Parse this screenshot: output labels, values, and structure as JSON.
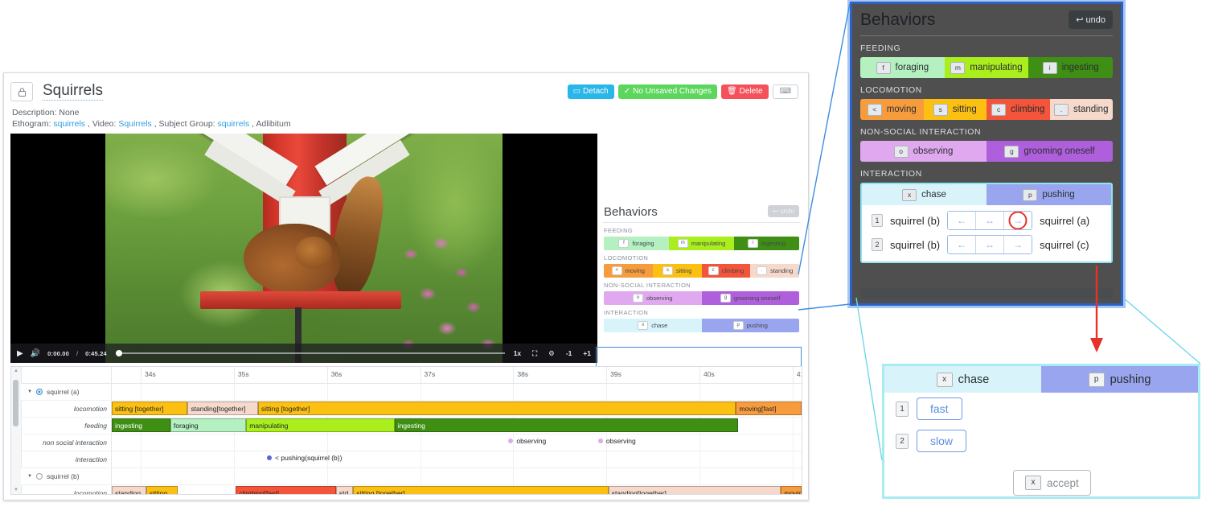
{
  "app": {
    "title": "Squirrels",
    "lock_icon": "lock-icon",
    "buttons": {
      "detach": "Detach",
      "detach_icon": "detach-icon",
      "saved": "No Unsaved Changes",
      "saved_icon": "check-icon",
      "delete": "Delete",
      "delete_icon": "trash-icon",
      "keyboard_icon": "keyboard-icon"
    },
    "meta": {
      "description_label": "Description:",
      "description_value": "None",
      "ethogram_label": "Ethogram:",
      "ethogram_value": "squirrels",
      "video_label": "Video:",
      "video_value": "Squirrels",
      "subject_group_label": "Subject Group:",
      "subject_group_value": "squirrels",
      "sampling": "Adlibitum"
    }
  },
  "video_controls": {
    "play_icon": "play-icon",
    "volume_icon": "volume-icon",
    "current_time": "0:00.00",
    "separator": "/",
    "duration": "0:45.24",
    "speed": "1x",
    "fullscreen_icon": "fullscreen-icon",
    "settings_icon": "gear-icon",
    "step_back": "-1",
    "step_forward": "+1"
  },
  "behaviors_panel": {
    "title": "Behaviors",
    "undo_label": "undo",
    "undo_icon": "undo-arrow-icon",
    "categories": [
      {
        "name": "FEEDING",
        "items": [
          {
            "key": "f",
            "label": "foraging",
            "color": "#b4f0c0"
          },
          {
            "key": "m",
            "label": "manipulating",
            "color": "#aaee1e"
          },
          {
            "key": "i",
            "label": "ingesting",
            "color": "#3f8f14"
          }
        ]
      },
      {
        "name": "LOCOMOTION",
        "items": [
          {
            "key": "<",
            "label": "moving",
            "color": "#f7a martin"
          },
          {
            "key": "s",
            "label": "sitting",
            "color": "#fcc012"
          },
          {
            "key": "c",
            "label": "climbing",
            "color": "#f4543a"
          },
          {
            "key": ".",
            "label": "standing",
            "color": "#f6d9cb"
          }
        ]
      },
      {
        "name": "NON-SOCIAL INTERACTION",
        "items": [
          {
            "key": "o",
            "label": "observing",
            "color": "#e0a9ef"
          },
          {
            "key": "g",
            "label": "grooming oneself",
            "color": "#b martin"
          }
        ]
      },
      {
        "name": "INTERACTION",
        "items": [
          {
            "key": "x",
            "label": "chase",
            "color": "#d8f4fa"
          },
          {
            "key": "p",
            "label": "pushing",
            "color": "#9aa5ef"
          }
        ]
      }
    ]
  },
  "colors": {
    "foraging": "#b4f0c0",
    "manipulating": "#aaee1e",
    "ingesting": "#3f8f14",
    "moving": "#f79c3c",
    "sitting": "#fcc012",
    "climbing": "#f4543a",
    "standing": "#f6d9cb",
    "observing": "#e0a9ef",
    "grooming": "#b05fdc",
    "chase": "#d8f4fa",
    "pushing": "#9aa5ef",
    "accent_blue": "#2f8fe0",
    "callout_blue": "#2b62c4",
    "callout_cyan": "#8fe3ef",
    "arrow_red": "#e8312a"
  },
  "timeline": {
    "ticks": [
      "34s",
      "35s",
      "36s",
      "37s",
      "38s",
      "39s",
      "40s",
      "41"
    ],
    "subjects": [
      {
        "name": "squirrel (a)",
        "selected": true,
        "rows": [
          {
            "label": "locomotion",
            "events": [
              {
                "text": "sitting [together]",
                "start": 0,
                "end": 11.0,
                "color": "#fcc012"
              },
              {
                "text": "standing[together]",
                "start": 11.0,
                "end": 21.2,
                "color": "#f6d9cb"
              },
              {
                "text": "sitting [together]",
                "start": 21.2,
                "end": 90.5,
                "color": "#fcc012"
              },
              {
                "text": "moving[fast]",
                "start": 90.5,
                "end": 100,
                "color": "#f79c3c"
              }
            ]
          },
          {
            "label": "feeding",
            "events": [
              {
                "text": "ingesting",
                "start": 0,
                "end": 8.5,
                "color": "#3f8f14"
              },
              {
                "text": "foraging",
                "start": 8.5,
                "end": 19.5,
                "color": "#b4f0c0"
              },
              {
                "text": "manipulating",
                "start": 19.5,
                "end": 41.0,
                "color": "#aaee1e"
              },
              {
                "text": "ingesting",
                "start": 41.0,
                "end": 90.8,
                "color": "#3f8f14"
              }
            ]
          },
          {
            "label": "non social interaction",
            "points": [
              {
                "text": "observing",
                "pos": 57.5,
                "color": "#e0a9ef"
              },
              {
                "text": "observing",
                "pos": 70.5,
                "color": "#e0a9ef"
              }
            ]
          },
          {
            "label": "interaction",
            "points": [
              {
                "text": "< pushing(squirrel (b))",
                "pos": 22.5,
                "color": "#5566dd"
              }
            ]
          }
        ]
      },
      {
        "name": "squirrel (b)",
        "selected": false,
        "rows": [
          {
            "label": "locomotion",
            "events": [
              {
                "text": "standing",
                "start": 0,
                "end": 5.0,
                "color": "#f6d9cb"
              },
              {
                "text": "sitting",
                "start": 5.0,
                "end": 9.5,
                "color": "#fcc012"
              },
              {
                "text": "",
                "start": 9.5,
                "end": 18.0,
                "color": "#ffffff"
              },
              {
                "text": "climbing[fast]",
                "start": 18.0,
                "end": 32.5,
                "color": "#f4543a"
              },
              {
                "text": "std",
                "start": 32.5,
                "end": 35.0,
                "color": "#f6d9cb"
              },
              {
                "text": "sitting [together]",
                "start": 35.0,
                "end": 72.0,
                "color": "#fcc012"
              },
              {
                "text": "standing[together]",
                "start": 72.0,
                "end": 86.0,
                "color": "#f6d9cb"
              },
              {
                "text": "moving[fa",
                "start": 97.0,
                "end": 100,
                "color": "#f79c3c"
              }
            ]
          }
        ]
      }
    ]
  },
  "zoom_behaviors": {
    "title": "Behaviors",
    "undo_label": "undo",
    "interaction_label": "INTERACTION",
    "tabs": [
      {
        "key": "x",
        "label": "chase",
        "color": "#d8f4fa"
      },
      {
        "key": "p",
        "label": "pushing",
        "color": "#9aa5ef"
      }
    ],
    "modifier_rows": [
      {
        "num": "1",
        "subject_left": "squirrel (b)",
        "subject_right": "squirrel (a)",
        "arrows": [
          "←",
          "↔",
          "→"
        ],
        "selected_arrow": 2,
        "highlighted": true
      },
      {
        "num": "2",
        "subject_left": "squirrel (b)",
        "subject_right": "squirrel (c)",
        "arrows": [
          "←",
          "↔",
          "→"
        ],
        "selected_arrow": -1,
        "highlighted": false
      }
    ]
  },
  "zoom_modifier": {
    "tabs": [
      {
        "key": "x",
        "label": "chase",
        "color": "#d8f4fa"
      },
      {
        "key": "p",
        "label": "pushing",
        "color": "#9aa5ef"
      }
    ],
    "modifiers": [
      {
        "num": "1",
        "label": "fast"
      },
      {
        "num": "2",
        "label": "slow"
      }
    ],
    "accept": {
      "key": "x",
      "label": "accept"
    }
  }
}
